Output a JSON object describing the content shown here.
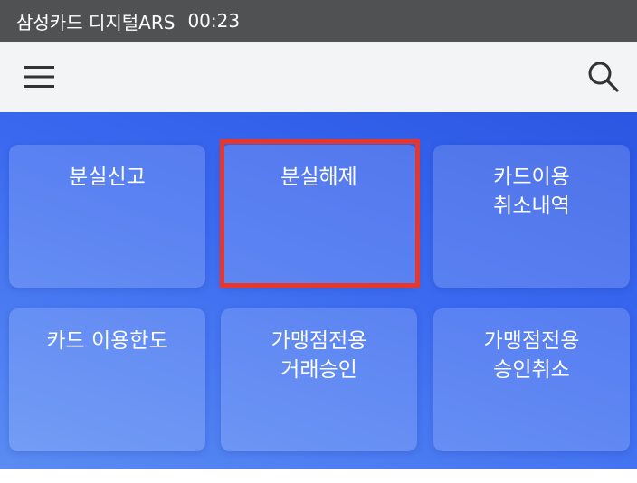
{
  "status_bar": {
    "title": "삼성카드 디지털ARS",
    "timer": "00:23"
  },
  "header": {
    "menu_icon": "hamburger-menu-icon",
    "search_icon": "search-icon"
  },
  "colors": {
    "status_bar_bg": "#505152",
    "header_bg": "#f3f4f6",
    "panel_gradient_start": "#2b56e3",
    "panel_gradient_end": "#5a8cf3",
    "highlight": "#e8372a"
  },
  "menu": {
    "items": [
      {
        "label": "분실신고"
      },
      {
        "label": "분실해제",
        "highlighted": true
      },
      {
        "label": "카드이용\n취소내역"
      },
      {
        "label": "카드 이용한도"
      },
      {
        "label": "가맹점전용\n거래승인"
      },
      {
        "label": "가맹점전용\n승인취소"
      }
    ]
  }
}
